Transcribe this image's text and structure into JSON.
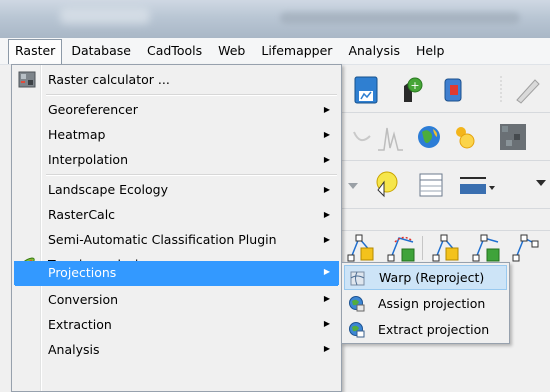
{
  "menubar": {
    "items": [
      {
        "label": "Raster",
        "active": true
      },
      {
        "label": "Database"
      },
      {
        "label": "CadTools"
      },
      {
        "label": "Web"
      },
      {
        "label": "Lifemapper"
      },
      {
        "label": "Analysis"
      },
      {
        "label": "Help"
      }
    ]
  },
  "raster_menu": {
    "items": [
      {
        "label": "Raster calculator ...",
        "icon": "raster-calculator-icon",
        "submenu": false
      },
      {
        "label": "Georeferencer",
        "submenu": true
      },
      {
        "label": "Heatmap",
        "submenu": true
      },
      {
        "label": "Interpolation",
        "submenu": true
      },
      {
        "label": "Landscape Ecology",
        "submenu": true
      },
      {
        "label": "RasterCalc",
        "submenu": true
      },
      {
        "label": "Semi-Automatic Classification Plugin",
        "submenu": true
      },
      {
        "label": "Terrain analysis",
        "icon": "terrain-analysis-icon",
        "submenu": true
      },
      {
        "label": "Projections",
        "submenu": true,
        "highlighted": true
      },
      {
        "label": "Conversion",
        "submenu": true
      },
      {
        "label": "Extraction",
        "submenu": true
      },
      {
        "label": "Analysis",
        "submenu": true
      }
    ],
    "arrow": "▶"
  },
  "projections_submenu": {
    "items": [
      {
        "label": "Warp (Reproject)",
        "icon": "warp-icon",
        "highlighted": true
      },
      {
        "label": "Assign projection",
        "icon": "assign-projection-icon"
      },
      {
        "label": "Extract projection",
        "icon": "extract-projection-icon"
      }
    ]
  },
  "colors": {
    "highlight": "#3399ff",
    "submenu_highlight": "#cde4f7"
  }
}
